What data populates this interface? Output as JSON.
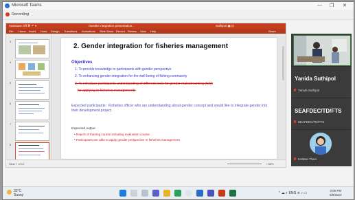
{
  "window": {
    "app_title": "Microsoft Teams",
    "controls": {
      "minimize": "—",
      "maximize": "❐",
      "close": "✕"
    }
  },
  "meeting": {
    "recording_label": "Recording"
  },
  "powerpoint": {
    "title_left": "Autosave  Off  ⌘  ↶  ▾",
    "title_center": "Gender integration presentation...",
    "title_right": "Suthipol  ▣  ⊡",
    "ribbon_tabs": [
      "File",
      "Home",
      "Insert",
      "Draw",
      "Design",
      "Transitions",
      "Animations",
      "Slide Show",
      "Record",
      "Review",
      "View",
      "Help"
    ],
    "ribbon_right": "Share",
    "thumb_numbers": [
      "3",
      "4",
      "5",
      "6",
      "7",
      "8"
    ],
    "status_left": "Slide 7 of 10",
    "status_right": "+ 88%"
  },
  "slide": {
    "title": "2. Gender integration for fisheries management",
    "objectives_heading": "Objectives",
    "objectives": [
      "1.   To provide knowledge to participants with gender perspective",
      "2.   To enhancing gender integration for the well-being of fishing community",
      "3.   To introduce participants understanding of different tools for gender mainstreaming (GM)"
    ],
    "objective_continued": "for applying to fisheries managements",
    "participants_text": "Expected participants : Fisheries officer who are understanding about gender concept and would like to integrate gender into their development project",
    "expected_output_heading": "Expected output",
    "expected_outputs": [
      "•   Report of training course including evaluation course",
      "•   Participants are able to apply gender perspective in fisheries management"
    ]
  },
  "participants": {
    "video_label": "SEAFDEC/TD",
    "tiles": [
      {
        "name": "Yanida Suthipol",
        "sub": "Yanida Suthipol"
      },
      {
        "name": "SEAFDEC/TD/FTS",
        "sub": "SEAFDEC/TD/FTS"
      },
      {
        "name": "",
        "sub": "Kottawi Thavi"
      }
    ]
  },
  "taskbar": {
    "weather_temp": "33°C",
    "weather_desc": "Sunny",
    "tray_icons": "^  ☁  ◐  ENG  ≋  ♪  ▭",
    "time": "3:06 PM",
    "date": "6/9/2023"
  },
  "colors": {
    "powerpoint_accent": "#c43e1c",
    "teams_dark": "#3b3b3b",
    "objective_blue": "#3737c8",
    "strike_red": "#d02020"
  }
}
